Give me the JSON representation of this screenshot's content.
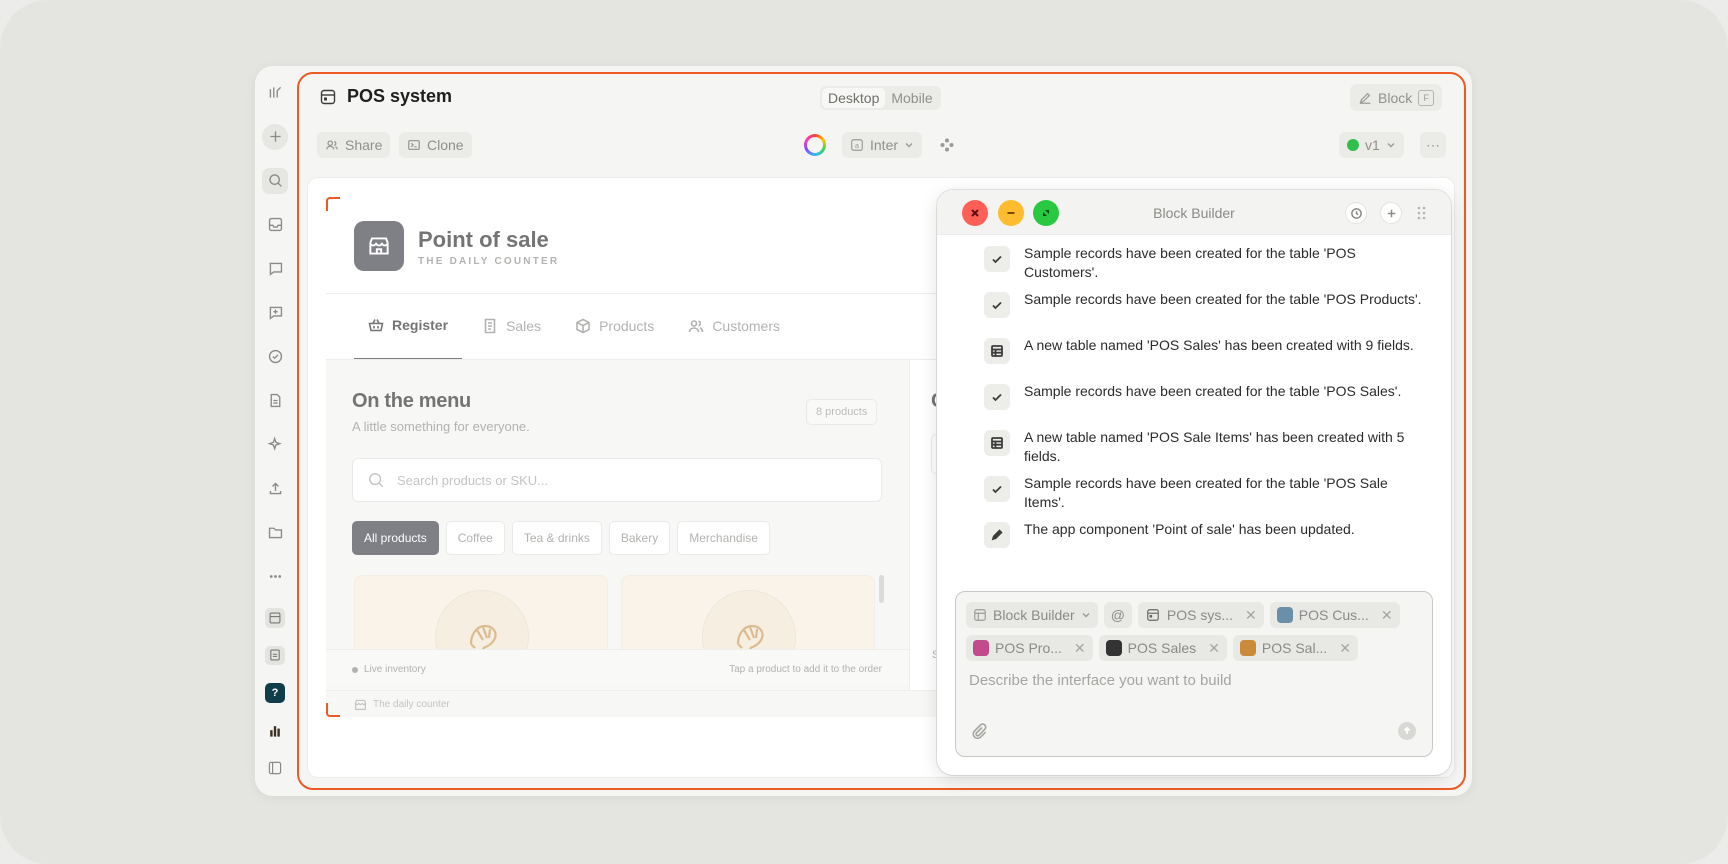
{
  "window": {
    "title": "POS system",
    "view_modes": [
      "Desktop",
      "Mobile"
    ],
    "active_view": "Desktop",
    "block_button": "Block",
    "block_shortcut": "F",
    "share_label": "Share",
    "clone_label": "Clone",
    "font_label": "Inter",
    "version_label": "v1",
    "accent_color": "#ee5a24"
  },
  "sidebar": {
    "icons": [
      "logo-icon",
      "plus-icon",
      "search-icon",
      "inbox-icon",
      "chat-icon",
      "chat-plus-icon",
      "check-circle-icon",
      "document-icon",
      "sparkle-icon",
      "upload-icon",
      "folder-icon",
      "more-icon"
    ],
    "apps": [
      "pos-app-icon",
      "doc-app-icon",
      "help-app-icon",
      "chart-app-icon",
      "panel-toggle-icon"
    ]
  },
  "preview": {
    "title": "Point of sale",
    "subtitle": "THE DAILY COUNTER",
    "tabs": [
      {
        "label": "Register",
        "icon": "basket-icon"
      },
      {
        "label": "Sales",
        "icon": "receipt-icon"
      },
      {
        "label": "Products",
        "icon": "box-icon"
      },
      {
        "label": "Customers",
        "icon": "users-icon"
      }
    ],
    "active_tab": "Register",
    "menu_title": "On the menu",
    "menu_subtitle": "A little something for everyone.",
    "product_count": "8 products",
    "search_placeholder": "Search products or SKU...",
    "categories": [
      "All products",
      "Coffee",
      "Tea & drinks",
      "Bakery",
      "Merchandise"
    ],
    "active_category": "All products",
    "live_inventory": "Live inventory",
    "tap_hint": "Tap a product to add it to the order",
    "right_heading_stub": "C",
    "right_footer_stub": "S",
    "footer_text": "The daily counter"
  },
  "block_builder": {
    "title": "Block Builder",
    "log": [
      {
        "icon": "check-icon",
        "text": "Sample records have been created for the table 'POS Customers'."
      },
      {
        "icon": "check-icon",
        "text": "Sample records have been created for the table 'POS Products'."
      },
      {
        "icon": "table-icon",
        "text": "A new table named 'POS Sales' has been created with 9 fields."
      },
      {
        "icon": "check-icon",
        "text": "Sample records have been created for the table 'POS Sales'."
      },
      {
        "icon": "table-icon",
        "text": "A new table named 'POS Sale Items' has been created with 5 fields."
      },
      {
        "icon": "check-icon",
        "text": "Sample records have been created for the table 'POS Sale Items'."
      },
      {
        "icon": "pencil-icon",
        "text": "The app component 'Point of sale' has been updated."
      }
    ],
    "composer": {
      "context_tags": [
        {
          "label": "Block Builder",
          "kind": "dropdown"
        },
        {
          "label": "@",
          "kind": "mention"
        },
        {
          "label": "POS sys...",
          "kind": "app",
          "removable": true
        },
        {
          "label": "POS Cus...",
          "kind": "table",
          "color": "#6b8fa8",
          "removable": true
        },
        {
          "label": "POS Pro...",
          "kind": "table",
          "color": "#c24a8a",
          "removable": true
        },
        {
          "label": "POS Sales",
          "kind": "table",
          "color": "#333333",
          "removable": true
        },
        {
          "label": "POS Sal...",
          "kind": "table",
          "color": "#c98a3a",
          "removable": true
        }
      ],
      "placeholder": "Describe the interface you want to build"
    }
  }
}
